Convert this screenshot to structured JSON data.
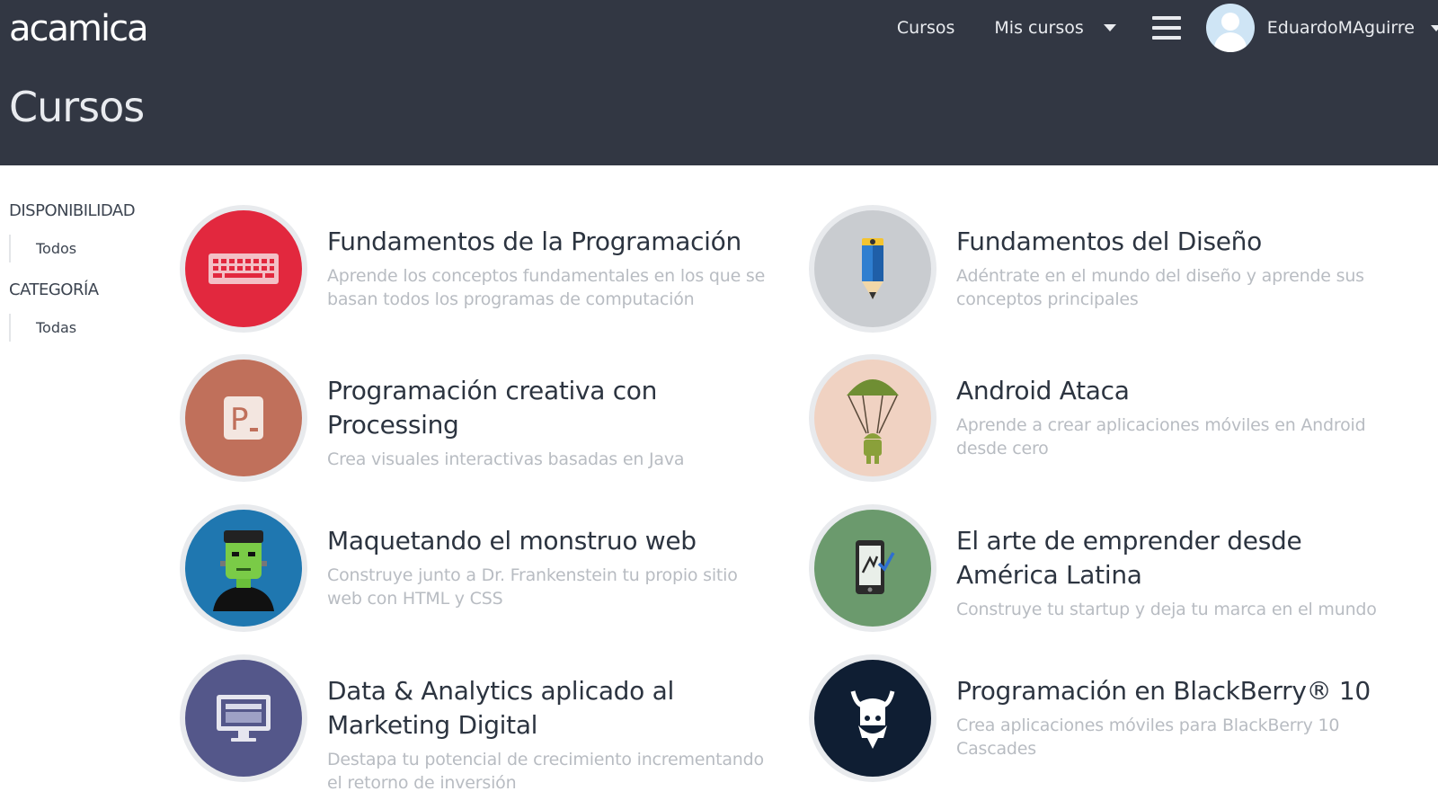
{
  "header": {
    "logo": "acamica",
    "nav": {
      "cursos": "Cursos",
      "mis_cursos": "Mis cursos",
      "user_name": "EduardoMAguirre"
    },
    "page_title": "Cursos"
  },
  "sidebar": {
    "availability_heading": "DISPONIBILIDAD",
    "availability_option": "Todos",
    "category_heading": "CATEGORÍA",
    "category_option": "Todas"
  },
  "courses": [
    {
      "title": "Fundamentos de la Programación",
      "description": "Aprende los conceptos fundamentales en los que se basan todos los programas de computación",
      "icon": "keyboard-icon",
      "color": "#e2283e"
    },
    {
      "title": "Fundamentos del Diseño",
      "description": "Adéntrate en el mundo del diseño y aprende sus conceptos principales",
      "icon": "pencil-icon",
      "color": "#c9ccd0"
    },
    {
      "title": "Programación creativa con Processing",
      "description": "Crea visuales interactivas basadas en Java",
      "icon": "processing-icon",
      "color": "#c0705b"
    },
    {
      "title": "Android Ataca",
      "description": "Aprende a crear aplicaciones móviles en Android desde cero",
      "icon": "android-parachute-icon",
      "color": "#f0d2c2"
    },
    {
      "title": "Maquetando el monstruo web",
      "description": "Construye junto a Dr. Frankenstein tu propio sitio web con HTML y CSS",
      "icon": "frankenstein-icon",
      "color": "#1f77b0"
    },
    {
      "title": "El arte de emprender desde América Latina",
      "description": "Construye tu startup y deja tu marca en el mundo",
      "icon": "phone-icon",
      "color": "#6b9a6d"
    },
    {
      "title": "Data & Analytics aplicado al Marketing Digital",
      "description": "Destapa tu potencial de crecimiento incrementando el retorno de inversión",
      "icon": "monitor-icon",
      "color": "#54578a"
    },
    {
      "title": "Programación en BlackBerry® 10",
      "description": "Crea aplicaciones móviles para BlackBerry 10 Cascades",
      "icon": "viking-icon",
      "color": "#0f1e33"
    }
  ]
}
